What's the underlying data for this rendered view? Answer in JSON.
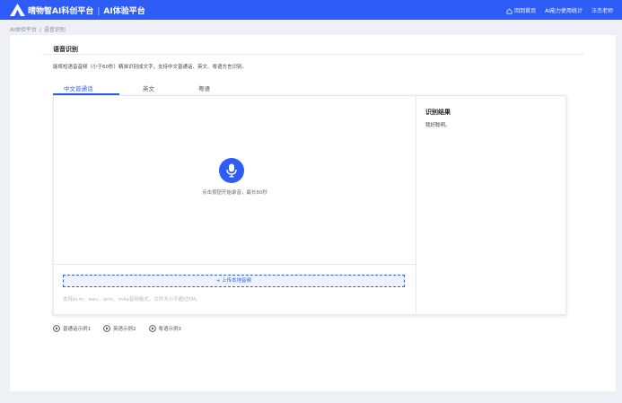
{
  "header": {
    "brand_name": "晴物智AI科创平台",
    "separator": "|",
    "platform_name": "AI体验平台",
    "nav": [
      "回到首页",
      "AI能力使用统计",
      "汪杰老师"
    ]
  },
  "breadcrumb": [
    "AI体验平台",
    "语音识别"
  ],
  "page": {
    "title": "语音识别",
    "description": "能将短语音音频（小于60秒）精准识别成文字，支持中文普通话、英文、粤语方言识别。"
  },
  "tabs": [
    {
      "label": "中文普通话",
      "active": true
    },
    {
      "label": "英文",
      "active": false
    },
    {
      "label": "粤语",
      "active": false
    }
  ],
  "recorder": {
    "hint": "点击按钮开始录音，最长60秒",
    "upload_label": "+ 上传本地音频",
    "upload_note": "支持pcm、wav、amr、m4a音频格式，文件大小不超过5M。"
  },
  "result": {
    "title": "识别结果",
    "text": "我好聪明。"
  },
  "samples": [
    "普通话示例1",
    "英语示例2",
    "粤语示例3"
  ],
  "colors": {
    "accent": "#2d5cf6",
    "background": "#eef0f5"
  },
  "icons": [
    "logo-icon",
    "home-icon",
    "microphone-icon",
    "play-icon"
  ]
}
